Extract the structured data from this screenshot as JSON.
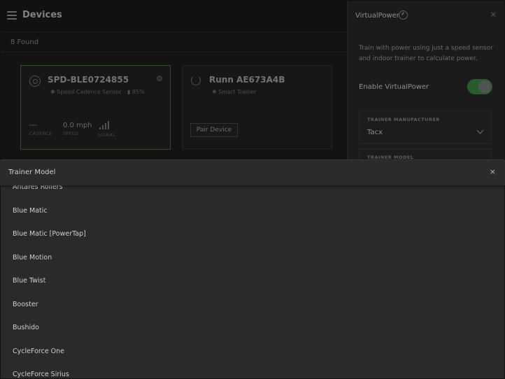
{
  "header": {
    "title": "Devices",
    "found": "8 Found"
  },
  "devices": [
    {
      "name": "SPD-BLE0724855",
      "type": "Speed Cadence Sensor",
      "battery": "85%",
      "metrics": [
        {
          "value": "---",
          "label": "CADENCE"
        },
        {
          "value": "0.0 mph",
          "label": "SPEED"
        },
        {
          "value": "",
          "label": "SIGNAL"
        }
      ]
    },
    {
      "name": "Runn AE673A4B",
      "type": "Smart Trainer",
      "pair_label": "Pair Device"
    }
  ],
  "virtualpower": {
    "title": "VirtualPower",
    "close": "×",
    "description": "Train with power using just a speed sensor and indoor trainer to calculate power.",
    "enable_label": "Enable VirtualPower",
    "enabled": true,
    "manufacturer_label": "TRAINER MANUFACTURER",
    "manufacturer_value": "Tacx",
    "model_label": "TRAINER MODEL"
  },
  "trainer_model_sheet": {
    "title": "Trainer Model",
    "close": "×",
    "items": [
      "Antares Rollers",
      "Blue Matic",
      "Blue Matic [PowerTap]",
      "Blue Motion",
      "Blue Twist",
      "Booster",
      "Bushido",
      "CycleForce One",
      "CycleForce Sirius"
    ]
  },
  "colors": {
    "accent": "#3c8a40",
    "active_card_border": "#3c7a38",
    "background": "#1c1c1c",
    "panel": "#282828"
  }
}
